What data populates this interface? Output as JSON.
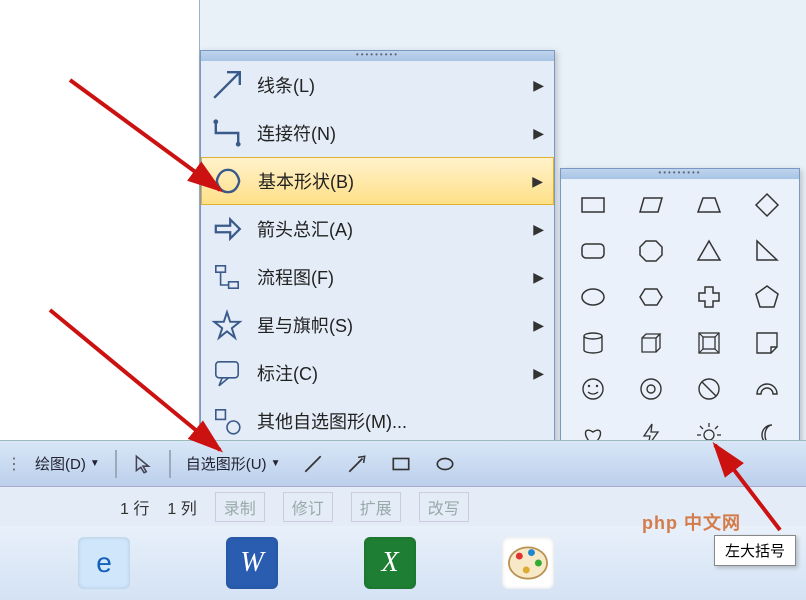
{
  "menu": {
    "items": [
      {
        "label": "线条(L)",
        "icon": "lines-icon",
        "arrow": true
      },
      {
        "label": "连接符(N)",
        "icon": "connector-icon",
        "arrow": true
      },
      {
        "label": "基本形状(B)",
        "icon": "basic-shapes-icon",
        "arrow": true,
        "highlighted": true
      },
      {
        "label": "箭头总汇(A)",
        "icon": "arrows-icon",
        "arrow": true
      },
      {
        "label": "流程图(F)",
        "icon": "flowchart-icon",
        "arrow": true
      },
      {
        "label": "星与旗帜(S)",
        "icon": "stars-icon",
        "arrow": true
      },
      {
        "label": "标注(C)",
        "icon": "callouts-icon",
        "arrow": true
      },
      {
        "label": "其他自选图形(M)...",
        "icon": "more-shapes-icon",
        "arrow": false
      }
    ]
  },
  "shapes_panel": {
    "rows": 8,
    "cols": 4,
    "highlighted_row": 7,
    "highlighted_cols": [
      2,
      3
    ]
  },
  "toolbar": {
    "draw_label": "绘图(D)",
    "autoshapes_label": "自选图形(U)"
  },
  "status": {
    "row_label": "1 行",
    "col_label": "1 列",
    "rec": "录制",
    "rev": "修订",
    "ext": "扩展",
    "ovr": "改写"
  },
  "tooltip": "左大括号",
  "watermark": "php 中文网"
}
